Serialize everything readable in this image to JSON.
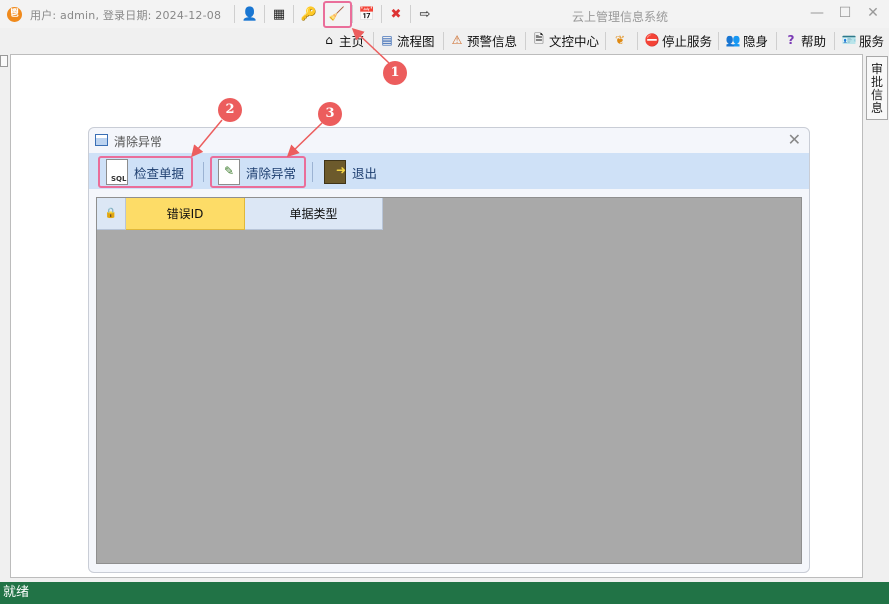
{
  "titlebar": {
    "logo_text": "鬯",
    "user_info": "用户: admin, 登录日期: 2024-12-08",
    "app_title": "云上管理信息系统",
    "minimize": "—",
    "maximize": "☐",
    "close": "✕"
  },
  "toolbar_icons": [
    {
      "name": "user-icon",
      "glyph": "👤"
    },
    {
      "name": "calculator-icon",
      "glyph": "▦"
    },
    {
      "name": "key-icon",
      "glyph": "🔑"
    },
    {
      "name": "broom-icon",
      "glyph": "🧹"
    },
    {
      "name": "calendar-icon",
      "glyph": "📅"
    },
    {
      "name": "stop-icon",
      "glyph": "✖"
    },
    {
      "name": "exit-icon",
      "glyph": "⇨"
    }
  ],
  "menu": {
    "home": "主页",
    "flow": "流程图",
    "alert": "预警信息",
    "doc_center": "文控中心",
    "stop_service": "停止服务",
    "hide": "隐身",
    "help": "帮助",
    "service": "服务"
  },
  "side_tab": "审批信息",
  "dialog": {
    "title": "清除异常",
    "close": "✕",
    "buttons": {
      "check": "检查单据",
      "clear": "清除异常",
      "exit": "退出"
    },
    "grid": {
      "lock": "🔒",
      "columns": [
        "错误ID",
        "单据类型"
      ]
    }
  },
  "callouts": [
    "1",
    "2",
    "3"
  ],
  "status": "就绪",
  "colors": {
    "status_bar": "#217346",
    "highlight": "#ea6e9a",
    "callout": "#ec5d5d",
    "toolbar_bg": "#cfe1f7",
    "active_column": "#fddc67"
  }
}
